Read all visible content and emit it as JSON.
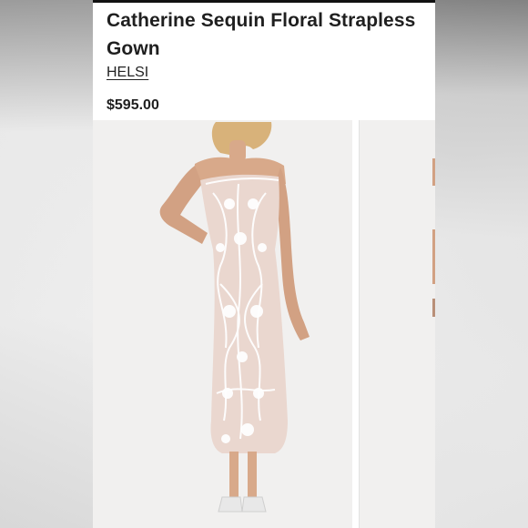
{
  "product": {
    "title": "Catherine Sequin Floral Strapless Gown",
    "brand": "HELSI",
    "price": "$595.00"
  },
  "gallery": {
    "images": [
      {
        "alt": "Model wearing strapless sequin floral gown"
      },
      {
        "alt": "Next product image"
      }
    ]
  },
  "colors": {
    "text": "#1f1f1f",
    "photo_bg": "#f1f0ef",
    "gown_base": "#ead7cf",
    "lace": "#ffffff",
    "skin": "#d8a98a"
  }
}
